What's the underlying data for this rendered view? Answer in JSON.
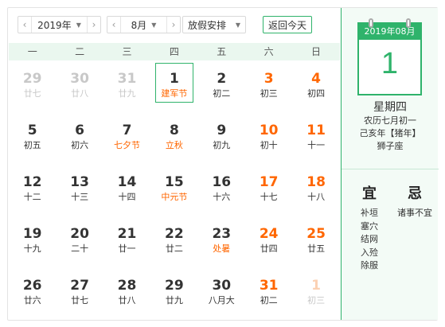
{
  "toolbar": {
    "year_value": "2019年",
    "month_value": "8月",
    "holiday_value": "放假安排",
    "today_label": "返回今天",
    "prev_arrow": "‹",
    "next_arrow": "›",
    "caret": "▼"
  },
  "weekdays": [
    "一",
    "二",
    "三",
    "四",
    "五",
    "六",
    "日"
  ],
  "weeks": [
    [
      {
        "day": "29",
        "lunar": "廿七",
        "faded": true
      },
      {
        "day": "30",
        "lunar": "廿八",
        "faded": true
      },
      {
        "day": "31",
        "lunar": "廿九",
        "faded": true
      },
      {
        "day": "1",
        "lunar": "建军节",
        "selected": true
      },
      {
        "day": "2",
        "lunar": "初二"
      },
      {
        "day": "3",
        "lunar": "初三",
        "weekend": true
      },
      {
        "day": "4",
        "lunar": "初四",
        "weekend": true
      }
    ],
    [
      {
        "day": "5",
        "lunar": "初五"
      },
      {
        "day": "6",
        "lunar": "初六"
      },
      {
        "day": "7",
        "lunar": "七夕节",
        "festival": true
      },
      {
        "day": "8",
        "lunar": "立秋",
        "festival": true
      },
      {
        "day": "9",
        "lunar": "初九"
      },
      {
        "day": "10",
        "lunar": "初十",
        "weekend": true
      },
      {
        "day": "11",
        "lunar": "十一",
        "weekend": true
      }
    ],
    [
      {
        "day": "12",
        "lunar": "十二"
      },
      {
        "day": "13",
        "lunar": "十三"
      },
      {
        "day": "14",
        "lunar": "十四"
      },
      {
        "day": "15",
        "lunar": "中元节",
        "festival": true
      },
      {
        "day": "16",
        "lunar": "十六"
      },
      {
        "day": "17",
        "lunar": "十七",
        "weekend": true
      },
      {
        "day": "18",
        "lunar": "十八",
        "weekend": true
      }
    ],
    [
      {
        "day": "19",
        "lunar": "十九"
      },
      {
        "day": "20",
        "lunar": "二十"
      },
      {
        "day": "21",
        "lunar": "廿一"
      },
      {
        "day": "22",
        "lunar": "廿二"
      },
      {
        "day": "23",
        "lunar": "处暑",
        "festival": true
      },
      {
        "day": "24",
        "lunar": "廿四",
        "weekend": true
      },
      {
        "day": "25",
        "lunar": "廿五",
        "weekend": true
      }
    ],
    [
      {
        "day": "26",
        "lunar": "廿六"
      },
      {
        "day": "27",
        "lunar": "廿七"
      },
      {
        "day": "28",
        "lunar": "廿八"
      },
      {
        "day": "29",
        "lunar": "廿九"
      },
      {
        "day": "30",
        "lunar": "八月大"
      },
      {
        "day": "31",
        "lunar": "初二",
        "weekend": true
      },
      {
        "day": "1",
        "lunar": "初三",
        "weekend": true,
        "faded": true
      }
    ]
  ],
  "panel": {
    "header": "2019年08月",
    "day": "1",
    "weekday": "星期四",
    "lunar_date": "农历七月初一",
    "ganzhi": "己亥年【猪年】",
    "zodiac": "狮子座",
    "yi_title": "宜",
    "ji_title": "忌",
    "yi_items": [
      "补垣",
      "塞穴",
      "结网",
      "入殓",
      "除服"
    ],
    "ji_items": [
      "诸事不宜"
    ]
  },
  "colors": {
    "accent": "#2fb36b",
    "weekend": "#ff6600",
    "faded": "#c8c8c8",
    "header_bg": "#eaf7ef",
    "panel_bg": "#f3fbf6"
  }
}
